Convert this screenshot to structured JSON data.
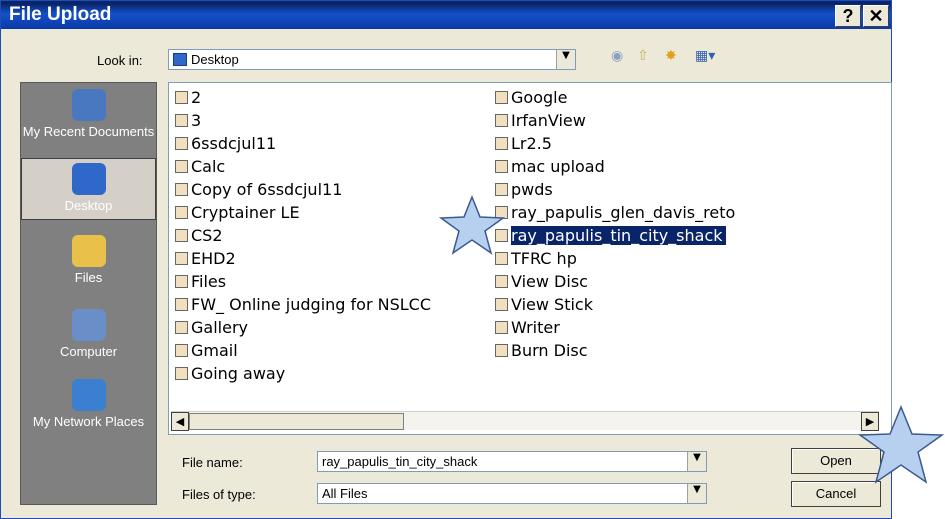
{
  "window": {
    "title": "File Upload",
    "help_btn": "?",
    "close_btn": "✕"
  },
  "lookin": {
    "label": "Look in:",
    "value": "Desktop"
  },
  "places": [
    {
      "label": "My Recent Documents",
      "icon": "recent-documents-icon",
      "color": "#4a78c0"
    },
    {
      "label": "Desktop",
      "icon": "desktop-icon",
      "color": "#2f68c8"
    },
    {
      "label": "Files",
      "icon": "folder-icon",
      "color": "#e8c04a"
    },
    {
      "label": "Computer",
      "icon": "computer-icon",
      "color": "#6a8fc8"
    },
    {
      "label": "My Network Places",
      "icon": "network-places-icon",
      "color": "#3a7fd0"
    }
  ],
  "files_col1": [
    "2",
    "3",
    "6ssdcjul11",
    "Calc",
    "Copy of 6ssdcjul11",
    "Cryptainer LE",
    "CS2",
    "EHD2",
    "Files",
    "FW_ Online judging for NSLCC",
    "Gallery",
    "Gmail",
    "Going away"
  ],
  "files_col2": [
    "Google",
    "IrfanView",
    "Lr2.5",
    "mac upload",
    "pwds",
    "ray_papulis_glen_davis_reto",
    "ray_papulis_tin_city_shack",
    "TFRC hp",
    "View Disc",
    "View Stick",
    "Writer",
    "Burn Disc"
  ],
  "selected_file": "ray_papulis_tin_city_shack",
  "filename": {
    "label": "File name:",
    "value": "ray_papulis_tin_city_shack"
  },
  "filetype": {
    "label": "Files of type:",
    "value": "All Files"
  },
  "buttons": {
    "open": "Open",
    "cancel": "Cancel"
  },
  "colors": {
    "title_bar": "#0b3aa8",
    "selection": "#0a246a",
    "star": "#b8d0f0",
    "dialog": "#ece9d8"
  }
}
